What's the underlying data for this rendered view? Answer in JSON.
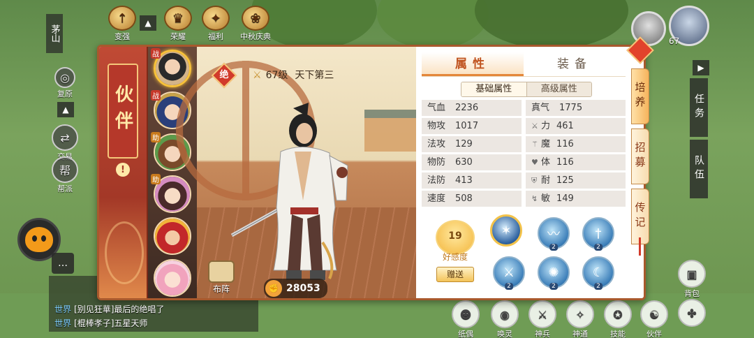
{
  "top_bar": {
    "buttons": [
      {
        "label": "变强",
        "icon": "plus-arrow-icon"
      },
      {
        "label": "荣耀",
        "icon": "crown-icon"
      },
      {
        "label": "福利",
        "icon": "gift-icon"
      },
      {
        "label": "中秋庆典",
        "icon": "rabbit-icon"
      }
    ],
    "location": "茅山"
  },
  "left_hud": {
    "buttons": [
      {
        "label": "复原",
        "icon": "restore-icon"
      },
      {
        "label": "交易",
        "icon": "trade-icon"
      },
      {
        "label": "帮派",
        "icon": "guild-icon",
        "glyph": "帮"
      }
    ]
  },
  "chat": {
    "lines": [
      {
        "channel": "世界",
        "text": "[别见狂華]最后的绝唱了"
      },
      {
        "channel": "世界",
        "text": "[棍棒孝子]五星天师"
      }
    ]
  },
  "player": {
    "level": "67"
  },
  "right_hud": {
    "quest_label": "任务",
    "team_label": "队伍"
  },
  "bottom_bar": {
    "buttons": [
      {
        "label": "纸偶",
        "icon": "puppet-icon"
      },
      {
        "label": "唤灵",
        "icon": "spirit-icon"
      },
      {
        "label": "神兵",
        "icon": "weapon-icon"
      },
      {
        "label": "神通",
        "icon": "magic-icon"
      },
      {
        "label": "技能",
        "icon": "skill-icon"
      },
      {
        "label": "伙伴",
        "icon": "partner-icon"
      }
    ],
    "bag_label": "背包"
  },
  "panel": {
    "banner_title": "伙伴",
    "roster": [
      {
        "tag": "战",
        "tag_type": "fight",
        "selected": true
      },
      {
        "tag": "战",
        "tag_type": "fight",
        "selected": false
      },
      {
        "tag": "助",
        "tag_type": "help",
        "selected": false
      },
      {
        "tag": "助",
        "tag_type": "help",
        "selected": false
      },
      {
        "tag": "",
        "tag_type": "",
        "selected": false
      },
      {
        "tag": "",
        "tag_type": "",
        "selected": false
      }
    ],
    "hero": {
      "tier": "绝",
      "level": "67级",
      "title": "天下第三",
      "power": "28053",
      "formation_label": "布阵"
    },
    "tabs": [
      {
        "label": "属性",
        "active": true
      },
      {
        "label": "装备",
        "active": false
      }
    ],
    "subtabs": [
      {
        "label": "基础属性",
        "active": true
      },
      {
        "label": "高级属性",
        "active": false
      }
    ],
    "stats": [
      [
        {
          "label": "气血",
          "value": "2236"
        },
        {
          "label": "真气",
          "value": "1775"
        }
      ],
      [
        {
          "label": "物攻",
          "value": "1017"
        },
        {
          "label": "力",
          "value": "461",
          "icon": "sword-icon"
        }
      ],
      [
        {
          "label": "法攻",
          "value": "129"
        },
        {
          "label": "魔",
          "value": "116",
          "icon": "wand-icon"
        }
      ],
      [
        {
          "label": "物防",
          "value": "630"
        },
        {
          "label": "体",
          "value": "116",
          "icon": "heart-icon"
        }
      ],
      [
        {
          "label": "法防",
          "value": "413"
        },
        {
          "label": "耐",
          "value": "125",
          "icon": "shield-icon"
        }
      ],
      [
        {
          "label": "速度",
          "value": "508"
        },
        {
          "label": "敏",
          "value": "149",
          "icon": "boot-icon"
        }
      ]
    ],
    "affinity": {
      "value": "19",
      "label": "好感度",
      "gift_label": "赠送"
    },
    "skills": [
      {
        "level": "",
        "main": true
      },
      {
        "level": "2"
      },
      {
        "level": "2"
      },
      {
        "level": "2"
      },
      {
        "level": "2"
      },
      {
        "level": "2"
      }
    ],
    "side_tabs": [
      {
        "label": "培养",
        "active": true
      },
      {
        "label": "招募",
        "active": false
      },
      {
        "label": "传记",
        "active": false
      }
    ]
  }
}
